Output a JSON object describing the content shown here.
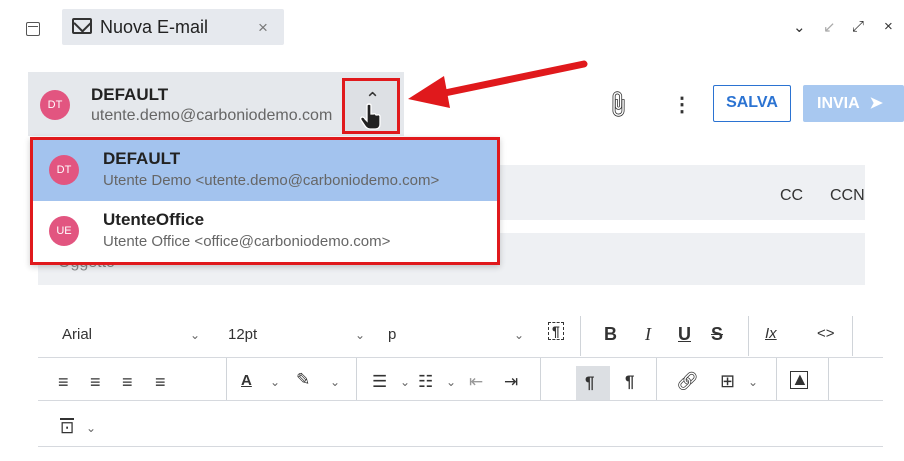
{
  "tab": {
    "title": "Nuova E-mail",
    "close": "×"
  },
  "window_controls": {
    "minimize": "⌄",
    "collapse": "↙",
    "expand": "⤢",
    "close": "×"
  },
  "sender": {
    "initials": "DT",
    "name": "DEFAULT",
    "email": "utente.demo@carboniodemo.com"
  },
  "actions": {
    "save": "SALVA",
    "send": "INVIA"
  },
  "recipients": {
    "cc": "CC",
    "ccn": "CCN"
  },
  "subject": {
    "placeholder": "Oggetto"
  },
  "dropdown": {
    "items": [
      {
        "initials": "DT",
        "name": "DEFAULT",
        "detail": "Utente Demo <utente.demo@carboniodemo.com>",
        "selected": true
      },
      {
        "initials": "UE",
        "name": "UtenteOffice",
        "detail": "Utente Office <office@carboniodemo.com>",
        "selected": false
      }
    ]
  },
  "toolbar": {
    "font_family": "Arial",
    "font_size": "12pt",
    "block_format": "p",
    "bold": "B",
    "italic": "I",
    "underline": "U",
    "strike": "S",
    "clear_format": "Ix",
    "code": "<>"
  },
  "colors": {
    "accent": "#2b73d2",
    "highlight": "#e0191c",
    "avatar": "#e25580",
    "selected": "#a3c3ee"
  }
}
